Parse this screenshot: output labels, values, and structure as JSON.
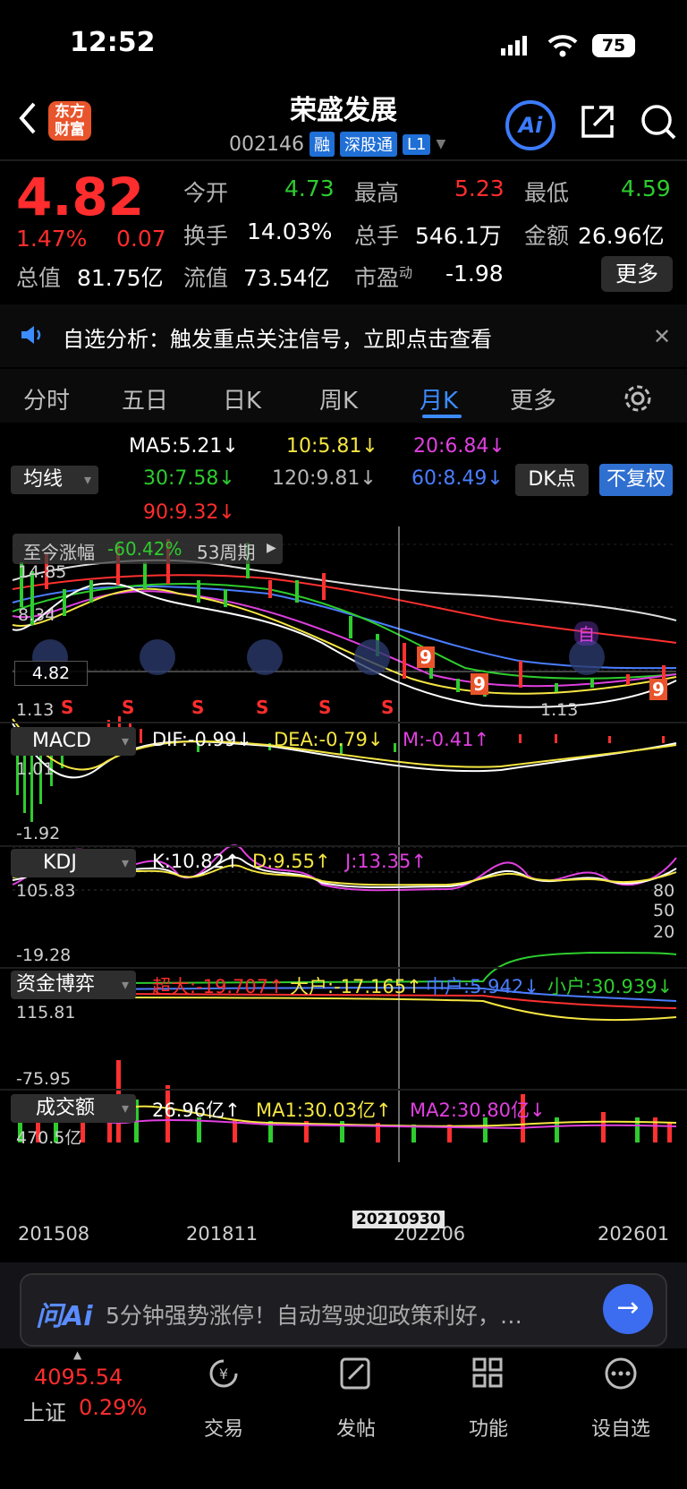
{
  "status_bar": {
    "time": "12:52",
    "battery": "75"
  },
  "header": {
    "title": "荣盛发展",
    "code": "002146",
    "tags": [
      "融",
      "深股通",
      "L1"
    ],
    "logo": "东方\n财富",
    "ai_label": "Ai"
  },
  "quote": {
    "price": "4.82",
    "change_pct": "1.47%",
    "change": "0.07",
    "open_label": "今开",
    "open": "4.73",
    "high_label": "最高",
    "high": "5.23",
    "low_label": "最低",
    "low": "4.59",
    "turnover_label": "换手",
    "turnover": "14.03%",
    "volume_label": "总手",
    "volume": "546.1万",
    "amount_label": "金额",
    "amount": "26.96亿",
    "mktcap_label": "总值",
    "mktcap": "81.75亿",
    "float_label": "流值",
    "float": "73.54亿",
    "pe_label": "市盈",
    "pe_sup": "动",
    "pe": "-1.98",
    "more_label": "更多"
  },
  "notice": {
    "text": "自选分析：触发重点关注信号，立即点击查看"
  },
  "tabs": [
    {
      "label": "分时"
    },
    {
      "label": "五日"
    },
    {
      "label": "日K"
    },
    {
      "label": "周K"
    },
    {
      "label": "月K"
    },
    {
      "label": "更多"
    }
  ],
  "ma_panel": {
    "select_label": "均线",
    "ma5": "MA5:5.21↓",
    "ma10": "10:5.81↓",
    "ma20": "20:6.84↓",
    "ma30": "30:7.58↓",
    "ma120": "120:9.81↓",
    "ma60": "60:8.49↓",
    "ma90": "90:9.32↓",
    "dk_label": "DK点",
    "adjust_label": "不复权"
  },
  "kline": {
    "since_label": "至今涨幅",
    "since_value": "-60.42%",
    "period": "53周期",
    "price_label": "4.82",
    "low_label": "1.13",
    "mid_label": "8.34",
    "low_mark": "1.13",
    "top_label": "14.85",
    "marker_text": "自",
    "s_marks": [
      "S",
      "S",
      "S",
      "S",
      "S",
      "S"
    ],
    "nine_marks": [
      "9",
      "9",
      "9"
    ]
  },
  "macd": {
    "select_label": "MACD",
    "dif": "DIF:-0.99↓",
    "dea": "DEA:-0.79↓",
    "m": "M:-0.41↑",
    "top": "1.01",
    "bottom": "-1.92"
  },
  "kdj": {
    "select_label": "KDJ",
    "k": "K:10.82↑",
    "d": "D:9.55↑",
    "j": "J:13.35↑",
    "top": "105.83",
    "bottom": "-19.28",
    "r80": "80",
    "r50": "50",
    "r20": "20"
  },
  "fund": {
    "select_label": "资金博弈",
    "super": "超大:-19.707↑",
    "big": "大户:-17.165↑",
    "mid": "中户:5.942↓",
    "small": "小户:30.939↓",
    "top": "115.81",
    "bottom": "-75.95"
  },
  "amount_panel": {
    "select_label": "成交额",
    "value": "26.96亿↑",
    "ma1": "MA1:30.03亿↑",
    "ma2": "MA2:30.80亿↓",
    "top": "470.5亿"
  },
  "x_axis": {
    "d1": "201508",
    "d2": "201811",
    "d3": "202206",
    "d4": "202601",
    "cursor": "20210930"
  },
  "ask_bar": {
    "logo": "问Ai",
    "text": "5分钟强势涨停！自动驾驶迎政策利好，…"
  },
  "bottom_nav": {
    "index_value": "4095.54",
    "index_name": "上证",
    "index_change": "0.29%",
    "items": [
      {
        "label": "交易",
        "icon": "yen-cycle-icon"
      },
      {
        "label": "发帖",
        "icon": "edit-icon"
      },
      {
        "label": "功能",
        "icon": "grid-icon"
      },
      {
        "label": "设自选",
        "icon": "more-dots-icon"
      }
    ]
  },
  "colors": {
    "up": "#ff2d2d",
    "down": "#2ecc2e",
    "accent": "#3c8cff"
  }
}
